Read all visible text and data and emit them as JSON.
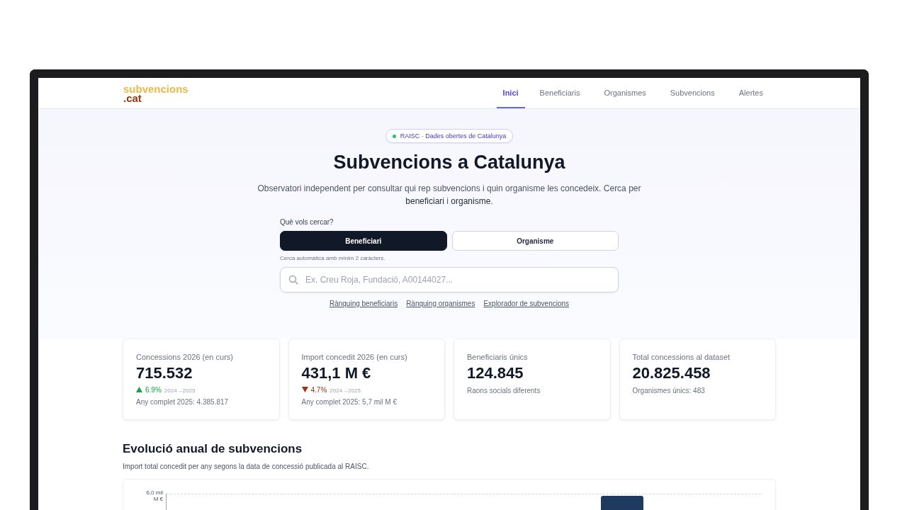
{
  "logo": {
    "line_1": "subvencions",
    "line_2": ".cat"
  },
  "nav": [
    {
      "label": "Inici",
      "selected": true
    },
    {
      "label": "Beneficiaris",
      "selected": false
    },
    {
      "label": "Organismes",
      "selected": false
    },
    {
      "label": "Subvencions",
      "selected": false
    },
    {
      "label": "Alertes",
      "selected": false
    }
  ],
  "hero": {
    "badge": "RAISC · Dades obertes de Catalunya",
    "title": "Subvencions a Catalunya",
    "description": "Observatori independent per consultar qui rep subvencions i quin organisme les concedeix. Cerca per **beneficiari** i **organisme**."
  },
  "search": {
    "label": "Què vols cercar?",
    "modes": [
      {
        "label": "Beneficiari",
        "selected": true
      },
      {
        "label": "Organisme",
        "selected": false
      }
    ],
    "hint": "Cerca automàtica amb mínim 2 caràcters.",
    "placeholder": "Ex. Creu Roja, Fundació, A00144027...",
    "links": [
      "Rànquing beneficiaris",
      "Rànquing organismes",
      "Explorador de subvencions"
    ]
  },
  "stats": [
    {
      "label": "Concessions 2026 (en curs)",
      "value": "715.532",
      "delta": {
        "kind": "up",
        "percent": "6.9%",
        "period": "2024→2025"
      },
      "note": "Any complet 2025: 4.385.817"
    },
    {
      "label": "Import concedit 2026 (en curs)",
      "value": "431,1 M €",
      "delta": {
        "kind": "down",
        "percent": "4.7%",
        "period": "2024→2025"
      },
      "note": "Any complet 2025: 5,7 mil M €"
    },
    {
      "label": "Beneficiaris únics",
      "value": "124.845",
      "note": "Raons socials diferents"
    },
    {
      "label": "Total concessions al dataset",
      "value": "20.825.458",
      "note": "Organismes únics: 483"
    }
  ],
  "evolution": {
    "title": "Evolució anual de subvencions",
    "subtitle": "Import total concedit per any segons la data de concessió publicada al RAISC.",
    "chart": {
      "tick_label": "6,0 mil M €"
    }
  }
}
